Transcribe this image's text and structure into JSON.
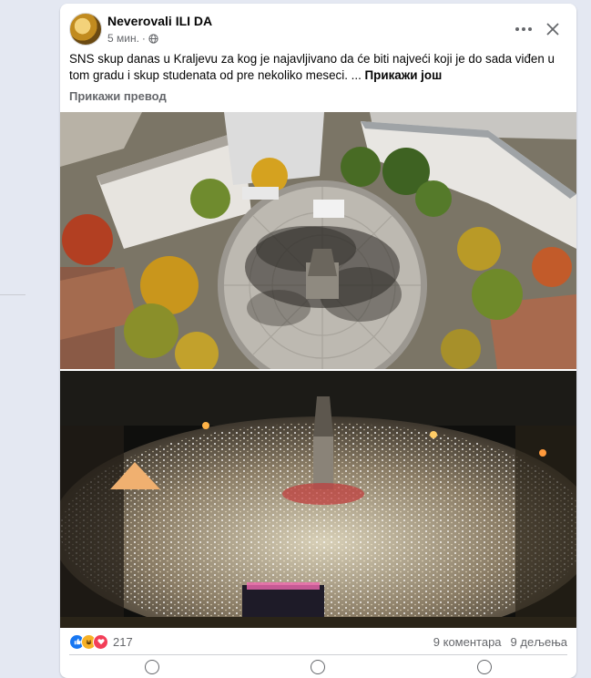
{
  "post": {
    "author": "Neverovali ILI DA",
    "time": "5 мин.",
    "separator": "·",
    "text": "SNS skup danas u Kraljevu za kog je najavljivano da će biti najveći koji je do sada viđen u tom gradu i skup studenata od pre nekoliko meseci. ...",
    "see_more": "Прикажи још",
    "translate": "Прикажи превод"
  },
  "reactions": {
    "types": [
      "like-icon",
      "haha-icon",
      "love-icon"
    ],
    "count": "217",
    "comments": "9 коментара",
    "shares": "9 дељења"
  },
  "colors": {
    "like": "#1877f2",
    "haha": "#f7b125",
    "love": "#f33e58",
    "page_bg": "#e4e8f2"
  }
}
